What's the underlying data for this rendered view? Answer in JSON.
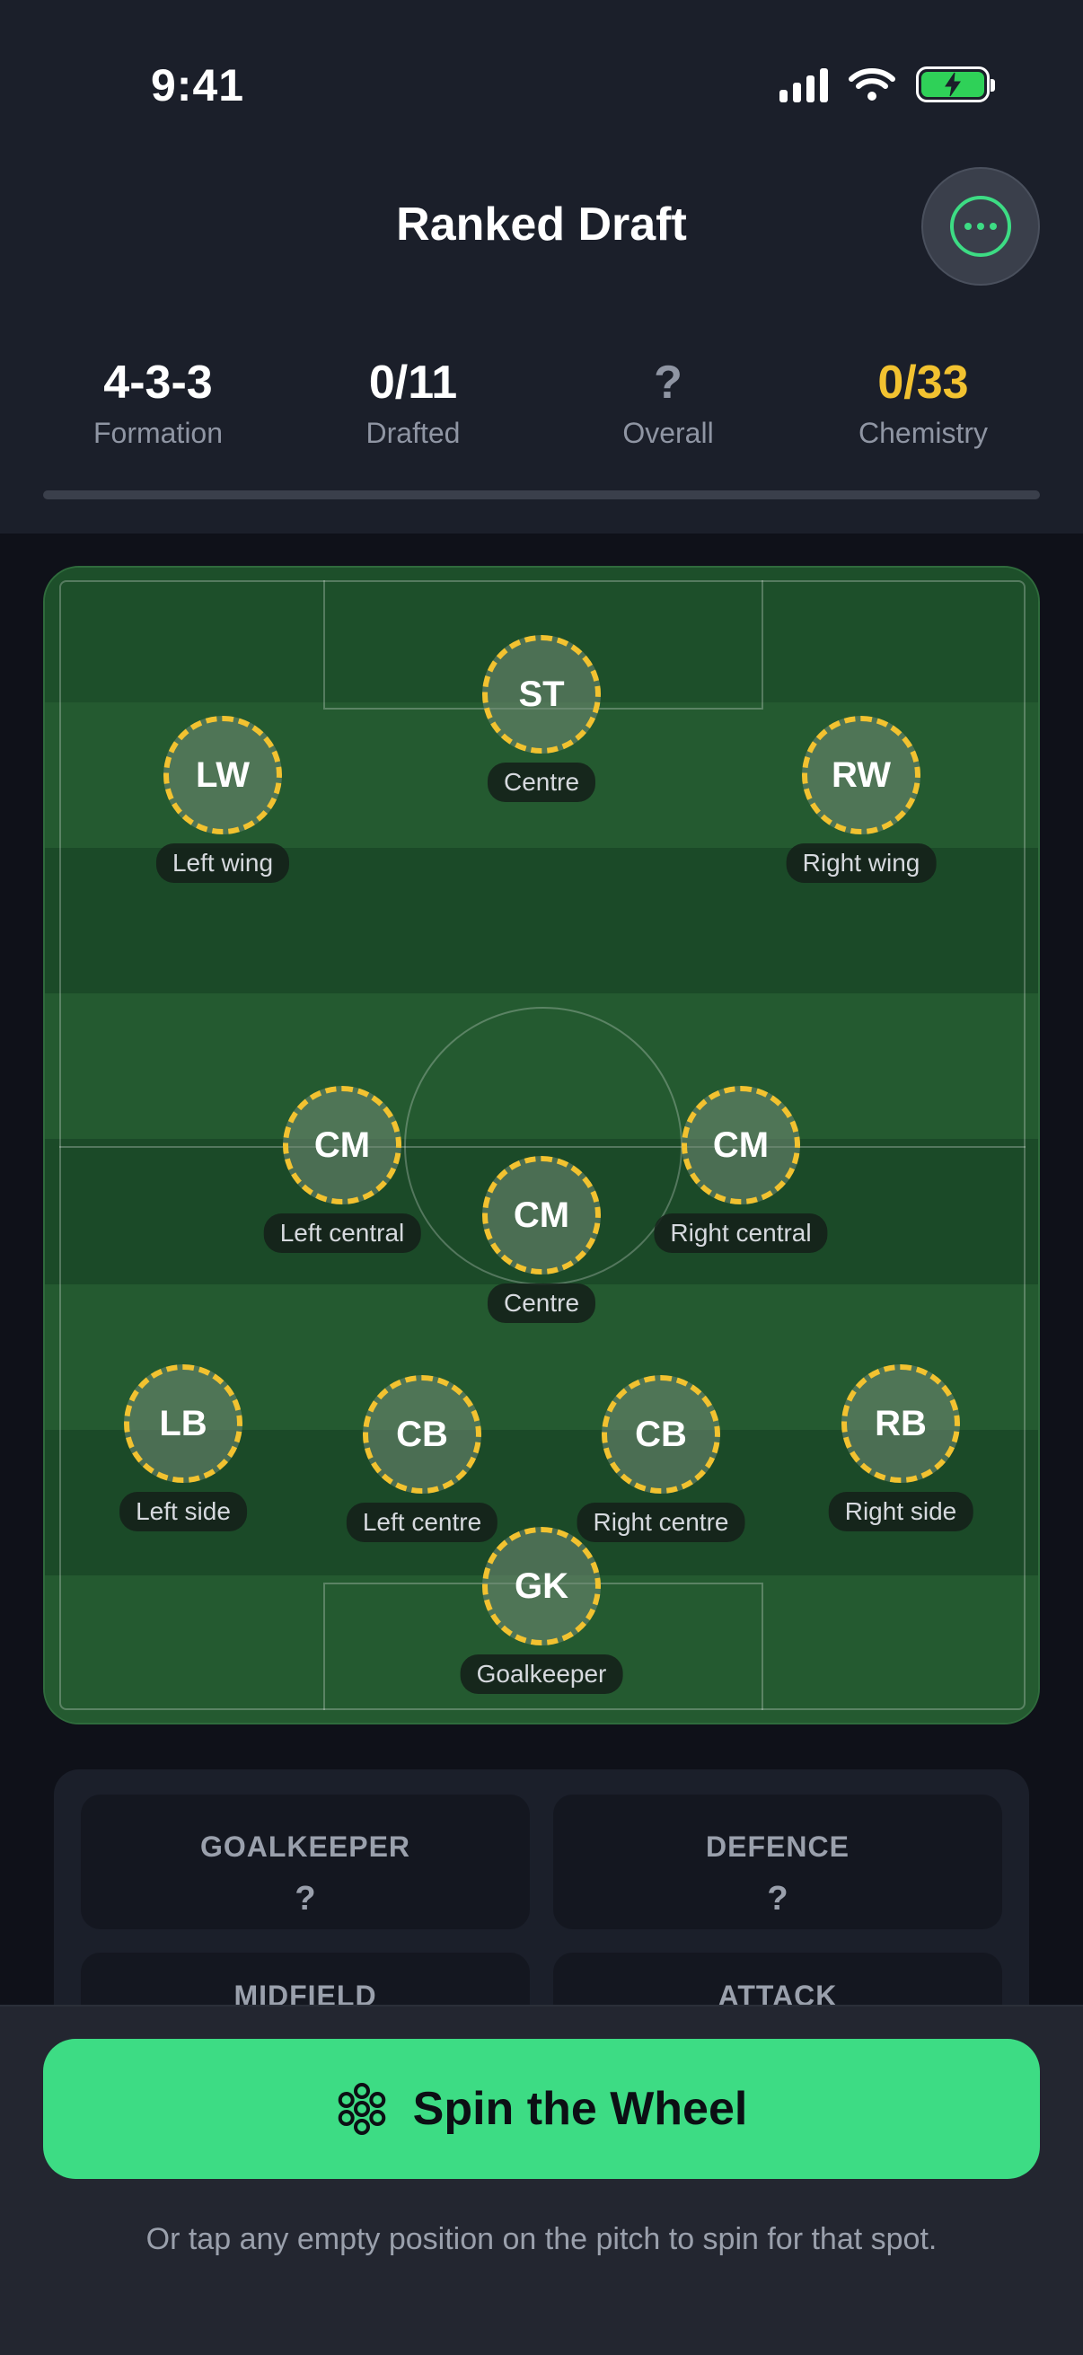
{
  "status": {
    "time": "9:41"
  },
  "header": {
    "title": "Ranked Draft"
  },
  "stats": [
    {
      "value": "4-3-3",
      "label": "Formation",
      "color": "#ffffff"
    },
    {
      "value": "0/11",
      "label": "Drafted",
      "color": "#ffffff"
    },
    {
      "value": "?",
      "label": "Overall",
      "color": "#8f95a3"
    },
    {
      "value": "0/33",
      "label": "Chemistry",
      "color": "#f2c230"
    }
  ],
  "draft_progress": 0,
  "positions": [
    {
      "code": "ST",
      "label": "Centre"
    },
    {
      "code": "LW",
      "label": "Left wing"
    },
    {
      "code": "RW",
      "label": "Right wing"
    },
    {
      "code": "CM",
      "label": "Left central"
    },
    {
      "code": "CM",
      "label": "Centre"
    },
    {
      "code": "CM",
      "label": "Right central"
    },
    {
      "code": "LB",
      "label": "Left side"
    },
    {
      "code": "CB",
      "label": "Left centre"
    },
    {
      "code": "CB",
      "label": "Right centre"
    },
    {
      "code": "RB",
      "label": "Right side"
    },
    {
      "code": "GK",
      "label": "Goalkeeper"
    }
  ],
  "lineup": [
    {
      "heading": "GOALKEEPER",
      "value": "?"
    },
    {
      "heading": "DEFENCE",
      "value": "?"
    },
    {
      "heading": "MIDFIELD",
      "value": "?"
    },
    {
      "heading": "ATTACK",
      "value": "?"
    }
  ],
  "action": {
    "spin_label": "Spin the Wheel",
    "hint": "Or tap any empty position on the pitch to spin for that spot."
  },
  "colors": {
    "accent": "#3ddc84",
    "chemistry": "#f2c230",
    "slot_border": "#f2c230"
  }
}
